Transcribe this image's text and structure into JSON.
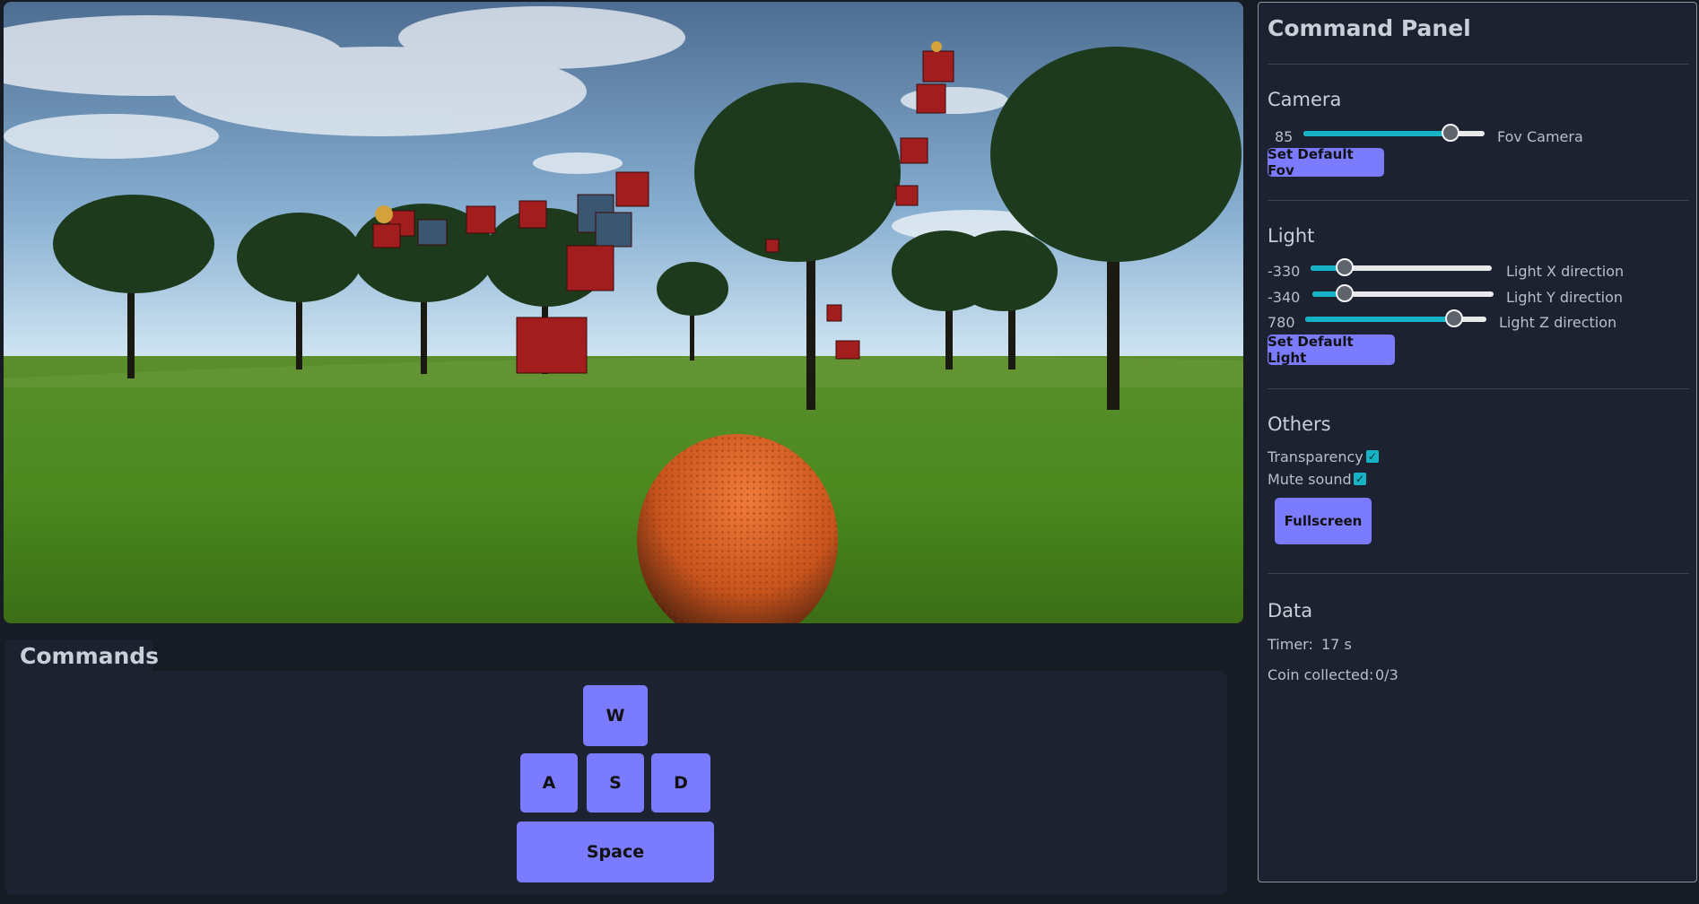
{
  "commands": {
    "title": "Commands",
    "keys": {
      "w": "W",
      "a": "A",
      "s": "S",
      "d": "D",
      "space": "Space"
    }
  },
  "panel": {
    "title": "Command Panel",
    "camera": {
      "heading": "Camera",
      "fov_value": "85",
      "fov_label": "Fov Camera",
      "fov_level_percent": 81,
      "default_button": "Set Default Fov"
    },
    "light": {
      "heading": "Light",
      "x_value": "-330",
      "x_label": "Light X direction",
      "x_level_percent": 19,
      "y_value": "-340",
      "y_label": "Light Y direction",
      "y_level_percent": 18,
      "z_value": "780",
      "z_label": "Light Z direction",
      "z_level_percent": 82,
      "default_button": "Set Default Light"
    },
    "others": {
      "heading": "Others",
      "transparency_label": "Transparency",
      "transparency_checked": true,
      "mute_label": "Mute sound",
      "mute_checked": true,
      "fullscreen_button": "Fullscreen"
    },
    "data": {
      "heading": "Data",
      "timer_label": "Timer:",
      "timer_value": "17 s",
      "coin_label": "Coin collected:",
      "coin_value": "0/3"
    }
  },
  "colors": {
    "accent": "#7b7bff",
    "slider_fill": "#16b3c7",
    "panel_bg": "#1c2230",
    "page_bg": "#171b24"
  }
}
